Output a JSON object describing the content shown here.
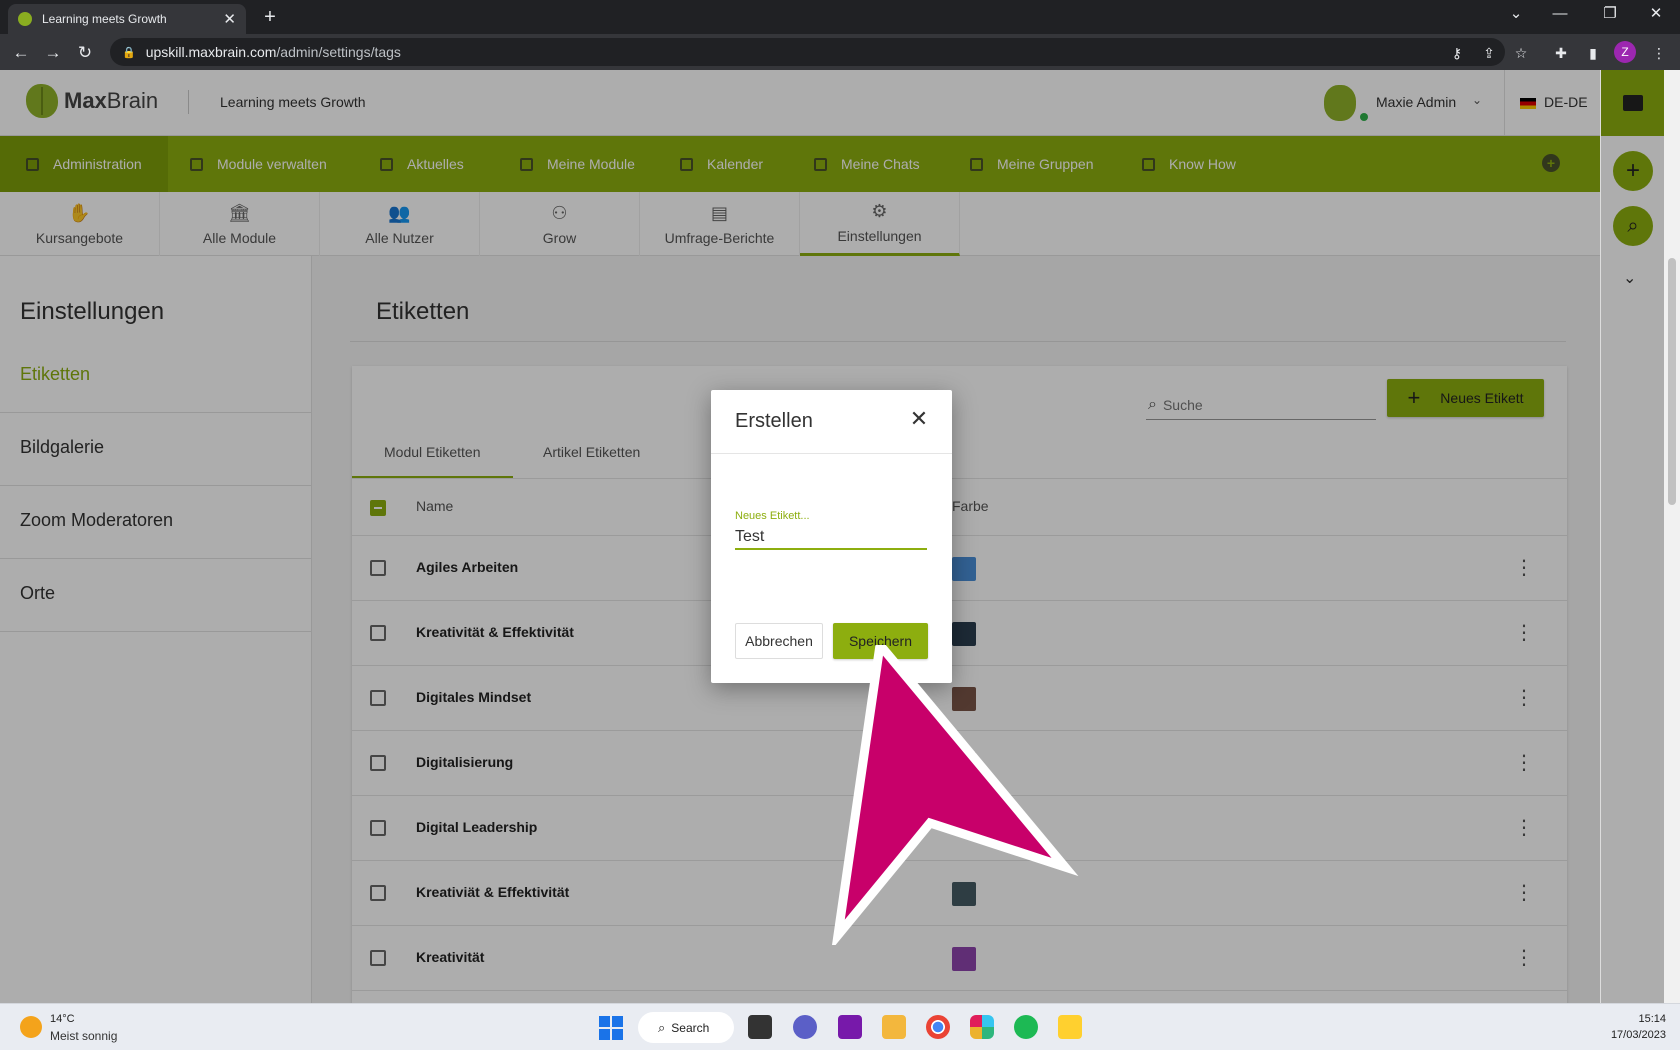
{
  "browser": {
    "tab_title": "Learning meets Growth",
    "url_host": "upskill.maxbrain.com",
    "url_path": "/admin/settings/tags",
    "profile_initial": "Z"
  },
  "header": {
    "logo_bold": "Max",
    "logo_light": "Brain",
    "tagline": "Learning meets Growth",
    "user_name": "Maxie Admin",
    "language": "DE-DE"
  },
  "main_nav": [
    {
      "label": "Administration"
    },
    {
      "label": "Module verwalten"
    },
    {
      "label": "Aktuelles"
    },
    {
      "label": "Meine Module"
    },
    {
      "label": "Kalender"
    },
    {
      "label": "Meine Chats"
    },
    {
      "label": "Meine Gruppen"
    },
    {
      "label": "Know How"
    }
  ],
  "sub_nav": [
    {
      "label": "Kursangebote",
      "icon": "book-hand-icon"
    },
    {
      "label": "Alle Module",
      "icon": "bank-icon"
    },
    {
      "label": "Alle Nutzer",
      "icon": "users-icon"
    },
    {
      "label": "Grow",
      "icon": "group-icon"
    },
    {
      "label": "Umfrage-Berichte",
      "icon": "report-icon"
    },
    {
      "label": "Einstellungen",
      "icon": "gears-icon"
    }
  ],
  "sidebar": {
    "title": "Einstellungen",
    "items": [
      {
        "label": "Etiketten"
      },
      {
        "label": "Bildgalerie"
      },
      {
        "label": "Zoom Moderatoren"
      },
      {
        "label": "Orte"
      }
    ]
  },
  "content": {
    "title": "Etiketten",
    "search_placeholder": "Suche",
    "new_button": "Neues Etikett",
    "tabs": [
      {
        "label": "Modul Etiketten"
      },
      {
        "label": "Artikel Etiketten"
      }
    ],
    "col_name": "Name",
    "col_color": "Farbe",
    "rows": [
      {
        "name": "Agiles Arbeiten",
        "color": "#4a90d9"
      },
      {
        "name": "Kreativität & Effektivität",
        "color": "#2c3e50"
      },
      {
        "name": "Digitales Mindset",
        "color": "#795548"
      },
      {
        "name": "Digitalisierung",
        "color": "#8d6e63"
      },
      {
        "name": "Digital Leadership",
        "color": ""
      },
      {
        "name": "Kreativiät & Effektivität",
        "color": "#455a64"
      },
      {
        "name": "Kreativität",
        "color": "#8e44ad"
      }
    ]
  },
  "modal": {
    "title": "Erstellen",
    "field_label": "Neues Etikett...",
    "field_value": "Test",
    "cancel": "Abbrechen",
    "save": "Speichern"
  },
  "taskbar": {
    "temperature": "14°C",
    "weather": "Meist sonnig",
    "search": "Search",
    "time": "15:14",
    "date": "17/03/2023"
  },
  "colors": {
    "brand_green": "#8dae0f",
    "arrow_pink": "#c8006a"
  }
}
